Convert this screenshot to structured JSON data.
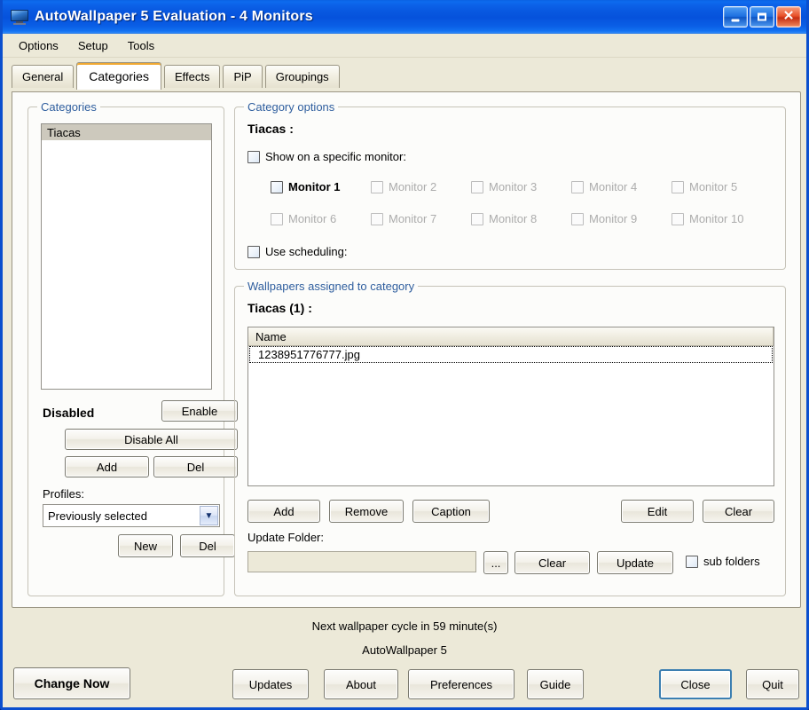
{
  "window": {
    "title": "AutoWallpaper 5 Evaluation  -  4 Monitors",
    "icon": "monitor-icon",
    "controls": {
      "minimize": "minimize-icon",
      "maximize": "maximize-icon",
      "close": "close-icon"
    },
    "colors": {
      "titlebar_blue": "#0A5FE6",
      "accent_orange": "#F0A830",
      "default_button_border": "#3C7FB1",
      "group_label_blue": "#2F5E9E",
      "dialog_bg": "#ECE9D8"
    }
  },
  "menubar": {
    "items": [
      "Options",
      "Setup",
      "Tools"
    ]
  },
  "tabs": [
    {
      "label": "General",
      "active": false
    },
    {
      "label": "Categories",
      "active": true
    },
    {
      "label": "Effects",
      "active": false
    },
    {
      "label": "PiP",
      "active": false
    },
    {
      "label": "Groupings",
      "active": false
    }
  ],
  "categories_group": {
    "legend": "Categories",
    "list": [
      {
        "label": "Tiacas",
        "selected": true
      }
    ],
    "status_label": "Disabled",
    "buttons": {
      "enable": "Enable",
      "disable_all": "Disable All",
      "add": "Add",
      "del": "Del"
    },
    "profiles_label": "Profiles:",
    "profile_selected": "Previously selected",
    "profile_dropdown_icon": "chevron-down-icon",
    "profile_buttons": {
      "new": "New",
      "del": "Del"
    }
  },
  "category_options": {
    "legend": "Category options",
    "title": "Tiacas :",
    "show_on_specific_monitor": {
      "label": "Show on a specific monitor:",
      "checked": false
    },
    "monitors": [
      {
        "label": "Monitor 1",
        "checked": false,
        "enabled": true
      },
      {
        "label": "Monitor 2",
        "checked": false,
        "enabled": false
      },
      {
        "label": "Monitor 3",
        "checked": false,
        "enabled": false
      },
      {
        "label": "Monitor 4",
        "checked": false,
        "enabled": false
      },
      {
        "label": "Monitor 5",
        "checked": false,
        "enabled": false
      },
      {
        "label": "Monitor 6",
        "checked": false,
        "enabled": false
      },
      {
        "label": "Monitor 7",
        "checked": false,
        "enabled": false
      },
      {
        "label": "Monitor 8",
        "checked": false,
        "enabled": false
      },
      {
        "label": "Monitor 9",
        "checked": false,
        "enabled": false
      },
      {
        "label": "Monitor 10",
        "checked": false,
        "enabled": false
      }
    ],
    "use_scheduling": {
      "label": "Use scheduling:",
      "checked": false
    }
  },
  "wallpapers": {
    "legend": "Wallpapers assigned to category",
    "title": "Tiacas (1) :",
    "column_header": "Name",
    "rows": [
      {
        "name": "1238951776777.jpg",
        "focused": true
      }
    ],
    "buttons": {
      "add": "Add",
      "remove": "Remove",
      "caption": "Caption",
      "edit": "Edit",
      "clear": "Clear"
    },
    "update_folder_label": "Update Folder:",
    "update_folder_value": "",
    "browse_label": "...",
    "update_clear": "Clear",
    "update_update": "Update",
    "sub_folders": {
      "label": "sub folders",
      "checked": false
    }
  },
  "status": {
    "cycle": "Next wallpaper cycle in 59 minute(s)",
    "app": "AutoWallpaper 5"
  },
  "bottom_buttons": {
    "change_now": "Change Now",
    "updates": "Updates",
    "about": "About",
    "preferences": "Preferences",
    "guide": "Guide",
    "close": "Close",
    "quit": "Quit"
  }
}
